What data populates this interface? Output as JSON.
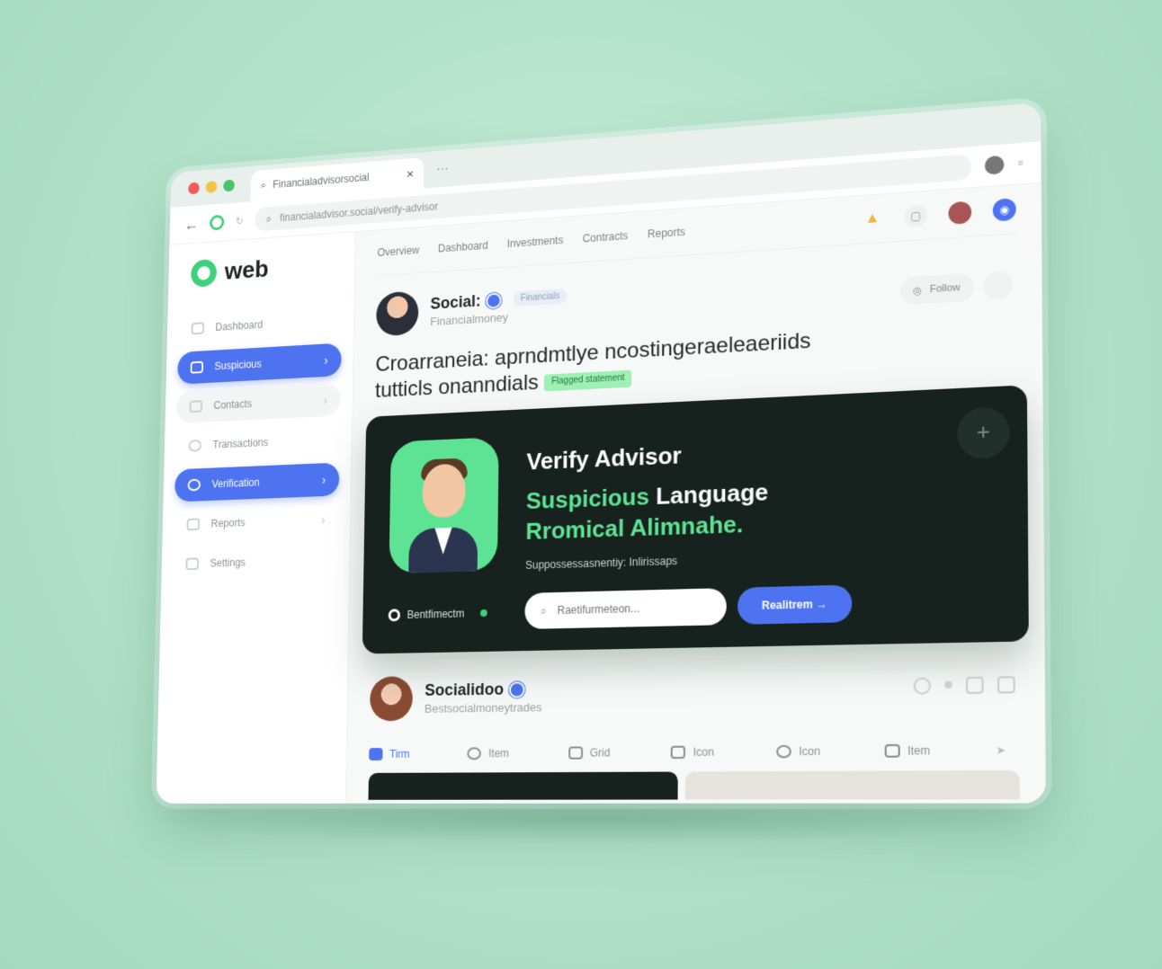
{
  "browser": {
    "tab_title": "Financialadvisorsocial",
    "url": "financialadvisor.social/verify-advisor"
  },
  "brand": {
    "name": "web"
  },
  "sidebar": {
    "items": [
      {
        "label": "Dashboard",
        "state": "plain"
      },
      {
        "label": "Suspicious",
        "state": "active"
      },
      {
        "label": "Contacts",
        "state": "soft"
      },
      {
        "label": "Transactions",
        "state": "plain"
      },
      {
        "label": "Verification",
        "state": "active"
      },
      {
        "label": "Reports",
        "state": "plain"
      },
      {
        "label": "Settings",
        "state": "plain"
      }
    ]
  },
  "topnav": {
    "links": [
      "Overview",
      "Dashboard",
      "Investments",
      "Contracts",
      "Reports"
    ]
  },
  "post1": {
    "name": "Social:",
    "tag": "Financials",
    "subtitle": "Financialmoney",
    "follow_label": "Follow",
    "headline_line1": "Croarraneia: aprndmtlye ncostingeraeleaeriids",
    "headline_line2": "tutticls onanndials",
    "headline_tag": "Flagged statement"
  },
  "card": {
    "title": "Verify Advisor",
    "line1_green": "Suspicious",
    "line1_white": "Language",
    "line2": "Rromical Alimnahe.",
    "subtitle": "Suppossessasnentiy: Inlirissaps",
    "status_label": "Bentfimectm",
    "search_placeholder": "Raetifurmeteon...",
    "cta_label": "Realitrem →"
  },
  "post2": {
    "name": "Socialidoo",
    "subtitle": "Bestsocialmoneytrades"
  },
  "bottom_tabs": [
    "Tirm",
    "Item",
    "Grid",
    "Icon",
    "Icon",
    "Item"
  ],
  "colors": {
    "accent_blue": "#4d73f0",
    "accent_green": "#5ee394",
    "card_dark": "#17221f"
  }
}
